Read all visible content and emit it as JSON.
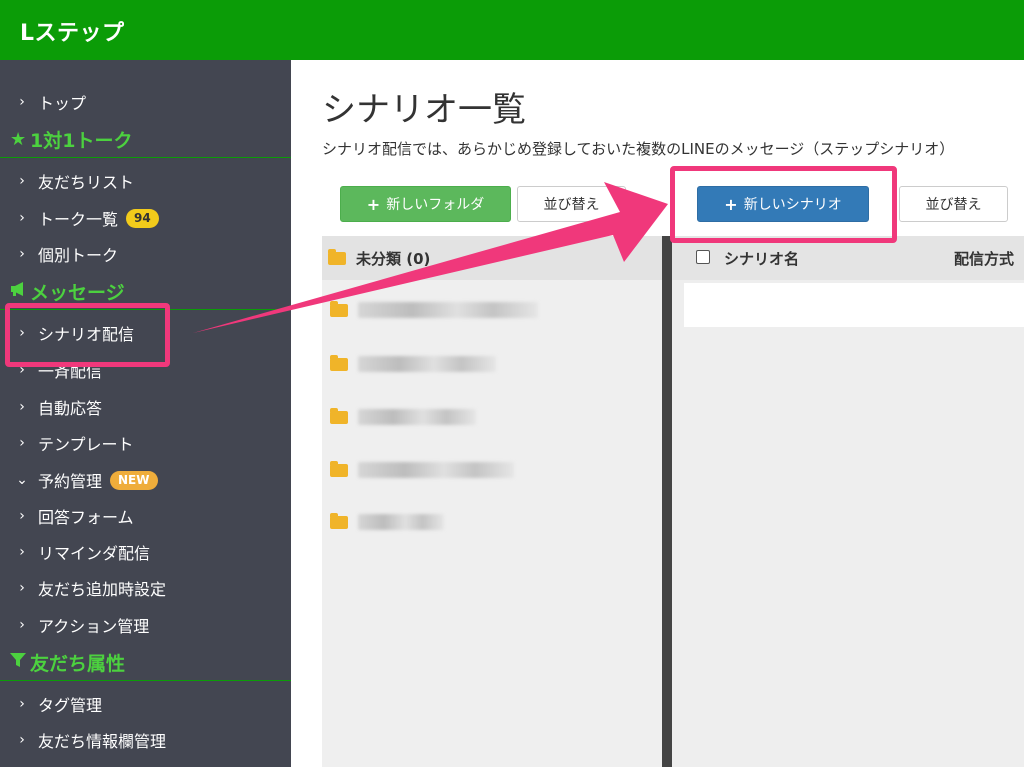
{
  "app": {
    "logo": "Lステップ"
  },
  "sidebar": {
    "items": [
      {
        "label": "トップ",
        "chevron": "›"
      },
      {
        "label": "友だちリスト",
        "chevron": "›"
      },
      {
        "label": "トーク一覧",
        "chevron": "›",
        "badge": "94"
      },
      {
        "label": "個別トーク",
        "chevron": "›"
      },
      {
        "label": "シナリオ配信",
        "chevron": "›"
      },
      {
        "label": "一斉配信",
        "chevron": "›"
      },
      {
        "label": "自動応答",
        "chevron": "›"
      },
      {
        "label": "テンプレート",
        "chevron": "›"
      },
      {
        "label": "予約管理",
        "chevron": "⌄",
        "badge": "NEW"
      },
      {
        "label": "回答フォーム",
        "chevron": "›"
      },
      {
        "label": "リマインダ配信",
        "chevron": "›"
      },
      {
        "label": "友だち追加時設定",
        "chevron": "›"
      },
      {
        "label": "アクション管理",
        "chevron": "›"
      },
      {
        "label": "タグ管理",
        "chevron": "›"
      },
      {
        "label": "友だち情報欄管理",
        "chevron": "›"
      }
    ],
    "sections": [
      {
        "label": "1対1トーク",
        "icon": "star-icon"
      },
      {
        "label": "メッセージ",
        "icon": "megaphone-icon"
      },
      {
        "label": "友だち属性",
        "icon": "filter-icon"
      }
    ]
  },
  "main": {
    "title": "シナリオ一覧",
    "description": "シナリオ配信では、あらかじめ登録しておいた複数のLINEのメッセージ（ステップシナリオ）",
    "buttons": {
      "new_folder": "新しいフォルダ",
      "sort_folders": "並び替え",
      "new_scenario": "新しいシナリオ",
      "sort_scenarios": "並び替え",
      "plus": "+"
    },
    "folders": {
      "header": "未分類 (0)"
    },
    "table": {
      "col_name": "シナリオ名",
      "col_method": "配信方式"
    }
  },
  "colors": {
    "topbar": "#0b9c07",
    "sidebar": "#434651",
    "section_heading": "#4cd13f",
    "highlight": "#f0387b",
    "primary_button": "#337ab7",
    "success_button": "#5cb85c"
  }
}
